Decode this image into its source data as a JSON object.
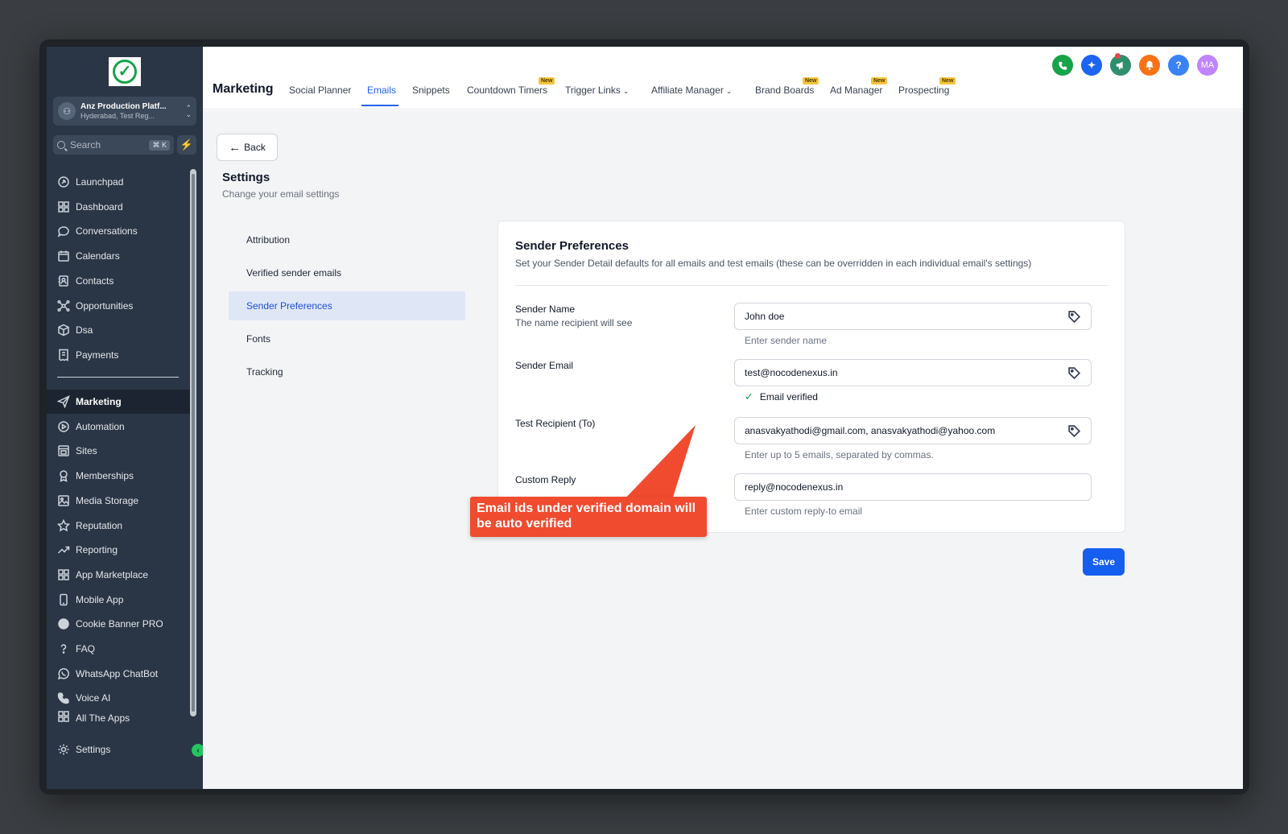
{
  "sidebar": {
    "account": {
      "name": "Anz Production Platf...",
      "location": "Hyderabad, Test Reg..."
    },
    "search": {
      "placeholder": "Search",
      "shortcut": "⌘ K"
    },
    "items": [
      {
        "label": "Launchpad",
        "icon": "rocket-icon"
      },
      {
        "label": "Dashboard",
        "icon": "grid-icon"
      },
      {
        "label": "Conversations",
        "icon": "chat-icon"
      },
      {
        "label": "Calendars",
        "icon": "calendar-icon"
      },
      {
        "label": "Contacts",
        "icon": "contact-icon"
      },
      {
        "label": "Opportunities",
        "icon": "network-icon"
      },
      {
        "label": "Dsa",
        "icon": "box-icon"
      },
      {
        "label": "Payments",
        "icon": "receipt-icon"
      }
    ],
    "items2": [
      {
        "label": "Marketing",
        "icon": "send-icon",
        "active": true
      },
      {
        "label": "Automation",
        "icon": "automation-icon"
      },
      {
        "label": "Sites",
        "icon": "sites-icon"
      },
      {
        "label": "Memberships",
        "icon": "membership-icon"
      },
      {
        "label": "Media Storage",
        "icon": "image-icon"
      },
      {
        "label": "Reputation",
        "icon": "star-icon"
      },
      {
        "label": "Reporting",
        "icon": "trend-icon"
      },
      {
        "label": "App Marketplace",
        "icon": "apps-icon"
      },
      {
        "label": "Mobile App",
        "icon": "mobile-icon"
      },
      {
        "label": "Cookie Banner PRO",
        "icon": "cookie-icon"
      },
      {
        "label": "FAQ",
        "icon": "question-icon"
      },
      {
        "label": "WhatsApp ChatBot",
        "icon": "whatsapp-icon"
      },
      {
        "label": "Voice AI",
        "icon": "phone-icon"
      },
      {
        "label": "All The Apps",
        "icon": "apps-icon"
      }
    ],
    "settings_label": "Settings"
  },
  "topbar": {
    "title": "Marketing",
    "tabs": [
      {
        "label": "Social Planner"
      },
      {
        "label": "Emails",
        "active": true
      },
      {
        "label": "Snippets"
      },
      {
        "label": "Countdown Timers",
        "badge": "New"
      },
      {
        "label": "Trigger Links",
        "dropdown": true
      },
      {
        "label": "Affiliate Manager",
        "dropdown": true
      },
      {
        "label": "Brand Boards",
        "badge": "New"
      },
      {
        "label": "Ad Manager",
        "badge": "New"
      },
      {
        "label": "Prospecting",
        "badge": "New"
      }
    ],
    "icons": [
      {
        "name": "phone-icon",
        "color": "#16a34a"
      },
      {
        "name": "sparkle-icon",
        "color": "#1d64f2"
      },
      {
        "name": "megaphone-icon",
        "color": "#2f8f6d"
      },
      {
        "name": "bell-icon",
        "color": "#f97316"
      },
      {
        "name": "help-icon",
        "color": "#3b82f6"
      }
    ],
    "help_glyph": "?",
    "avatar": {
      "initials": "MA",
      "color": "#c084fc"
    }
  },
  "page": {
    "back_label": "Back",
    "title": "Settings",
    "subtitle": "Change your email settings",
    "settings_nav": [
      {
        "label": "Attribution"
      },
      {
        "label": "Verified sender emails"
      },
      {
        "label": "Sender Preferences",
        "active": true
      },
      {
        "label": "Fonts"
      },
      {
        "label": "Tracking"
      }
    ]
  },
  "card": {
    "title": "Sender Preferences",
    "subtitle": "Set your Sender Detail defaults for all emails and test emails (these can be overridden in each individual email's settings)",
    "sender_name": {
      "label": "Sender Name",
      "sublabel": "The name recipient will see",
      "value": "John doe",
      "help": "Enter sender name"
    },
    "sender_email": {
      "label": "Sender Email",
      "value": "test@nocodenexus.in",
      "verified": "Email verified"
    },
    "test_recipient": {
      "label": "Test Recipient (To)",
      "value": "anasvakyathodi@gmail.com, anasvakyathodi@yahoo.com",
      "help": "Enter up to 5 emails, separated by commas."
    },
    "custom_reply": {
      "label": "Custom Reply",
      "value": "reply@nocodenexus.in",
      "help": "Enter custom reply-to email"
    },
    "save_label": "Save"
  },
  "annotation": {
    "text": "Email ids under verified domain will be auto verified",
    "color": "#f04b2f"
  }
}
